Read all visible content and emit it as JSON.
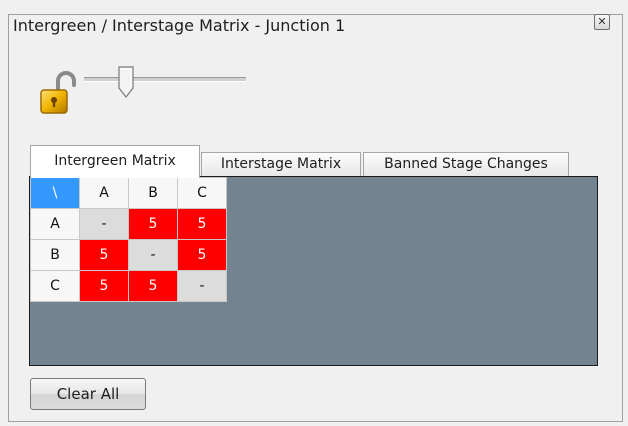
{
  "window": {
    "title": "Intergreen / Interstage Matrix - Junction 1",
    "close_glyph": "✕"
  },
  "lock": {
    "icon": "unlocked-padlock-icon",
    "state": "unlocked"
  },
  "slider": {
    "value": 0.2
  },
  "tabs": [
    {
      "label": "Intergreen Matrix",
      "active": true
    },
    {
      "label": "Interstage Matrix",
      "active": false
    },
    {
      "label": "Banned Stage Changes",
      "active": false
    }
  ],
  "matrix": {
    "corner": "\\",
    "columns": [
      "A",
      "B",
      "C"
    ],
    "rows": [
      {
        "label": "A",
        "cells": [
          "-",
          "5",
          "5"
        ]
      },
      {
        "label": "B",
        "cells": [
          "5",
          "-",
          "5"
        ]
      },
      {
        "label": "C",
        "cells": [
          "5",
          "5",
          "-"
        ]
      }
    ]
  },
  "buttons": {
    "clear_all": "Clear All"
  },
  "colors": {
    "selected_header": "#3399ff",
    "conflict": "#ff0000",
    "panel_bg": "#738390"
  }
}
